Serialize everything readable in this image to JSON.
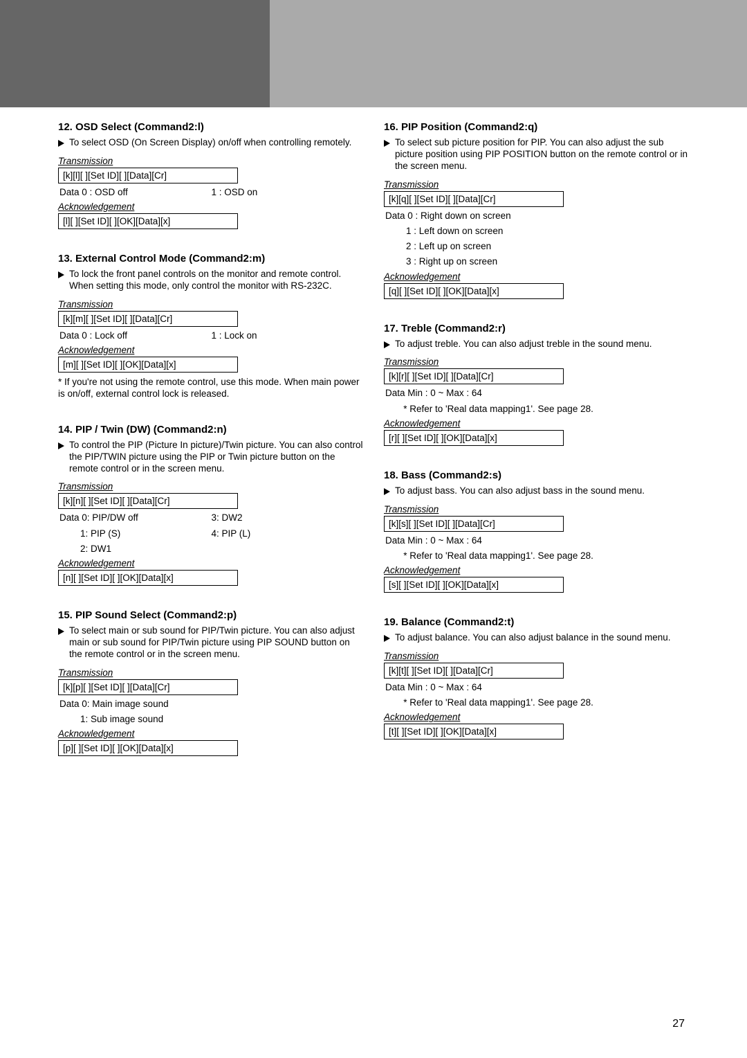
{
  "labels": {
    "trans": "Transmission",
    "ack": "Acknowledgement"
  },
  "page": "27",
  "left": {
    "s12": {
      "title": "12. OSD Select (Command2:l)",
      "desc": "To select OSD (On Screen Display) on/off when controlling remotely.",
      "tx": "[k][l][  ][Set ID][  ][Data][Cr]",
      "d1": "Data 0  : OSD off",
      "d2": "1 : OSD on",
      "ak": "[l][  ][Set ID][  ][OK][Data][x]"
    },
    "s13": {
      "title": "13. External Control Mode (Command2:m)",
      "desc": "To lock the front panel controls on the monitor and remote control. When setting this mode, only control the monitor with RS-232C.",
      "tx": "[k][m][  ][Set ID][  ][Data][Cr]",
      "d1": "Data 0  : Lock off",
      "d2": "1 : Lock on",
      "ak": "[m][  ][Set ID][  ][OK][Data][x]",
      "note": "* If you're not using the remote control, use this mode. When main power is on/off, external control lock is released."
    },
    "s14": {
      "title": "14. PIP / Twin (DW) (Command2:n)",
      "desc": "To control the PIP (Picture In picture)/Twin picture. You can also control the PIP/TWIN picture using the PIP or Twin picture button on the remote control or in the screen menu.",
      "tx": "[k][n][  ][Set ID][  ][Data][Cr]",
      "c1a": "Data  0: PIP/DW off",
      "c2a": "3: DW2",
      "c1b": "        1: PIP (S)",
      "c2b": "4: PIP (L)",
      "c1c": "        2: DW1",
      "ak": "[n][  ][Set ID][  ][OK][Data][x]"
    },
    "s15": {
      "title": "15. PIP Sound Select (Command2:p)",
      "desc": "To select main or sub sound for PIP/Twin picture. You can also adjust main or sub sound for PIP/Twin picture using PIP SOUND button on the remote control or in the screen menu.",
      "tx": "[k][p][  ][Set ID][  ][Data][Cr]",
      "d1": "Data  0: Main image sound",
      "d2": "        1: Sub image sound",
      "ak": "[p][  ][Set ID][  ][OK][Data][x]"
    }
  },
  "right": {
    "s16": {
      "title": "16. PIP Position (Command2:q)",
      "desc": "To select sub picture position for PIP. You can also adjust the sub picture position using PIP POSITION button on the remote control or in the screen menu.",
      "tx": "[k][q][  ][Set ID][  ][Data][Cr]",
      "d1": "Data  0  : Right down on screen",
      "d2": "        1  : Left down on screen",
      "d3": "        2  : Left up on screen",
      "d4": "        3  : Right up on screen",
      "ak": "[q][  ][Set ID][  ][OK][Data][x]"
    },
    "s17": {
      "title": "17. Treble (Command2:r)",
      "desc": "To adjust treble.\nYou can also adjust treble in the sound menu.",
      "tx": "[k][r][  ][Set ID][  ][Data][Cr]",
      "d1": "Data   Min : 0 ~ Max : 64",
      "d2": "       * Refer to 'Real data mapping1'.  See page 28.",
      "ak": "[r][  ][Set ID][  ][OK][Data][x]"
    },
    "s18": {
      "title": "18. Bass (Command2:s)",
      "desc": "To adjust bass.\nYou can also adjust bass in the sound menu.",
      "tx": "[k][s][  ][Set ID][  ][Data][Cr]",
      "d1": "Data   Min : 0 ~ Max : 64",
      "d2": "       * Refer to 'Real data mapping1'.  See page 28.",
      "ak": "[s][  ][Set ID][  ][OK][Data][x]"
    },
    "s19": {
      "title": "19. Balance (Command2:t)",
      "desc": "To adjust balance.\nYou can also adjust balance in the sound menu.",
      "tx": "[k][t][  ][Set ID][  ][Data][Cr]",
      "d1": "Data   Min : 0 ~ Max : 64",
      "d2": "       * Refer to 'Real data mapping1'. See page 28.",
      "ak": "[t][  ][Set ID][  ][OK][Data][x]"
    }
  }
}
